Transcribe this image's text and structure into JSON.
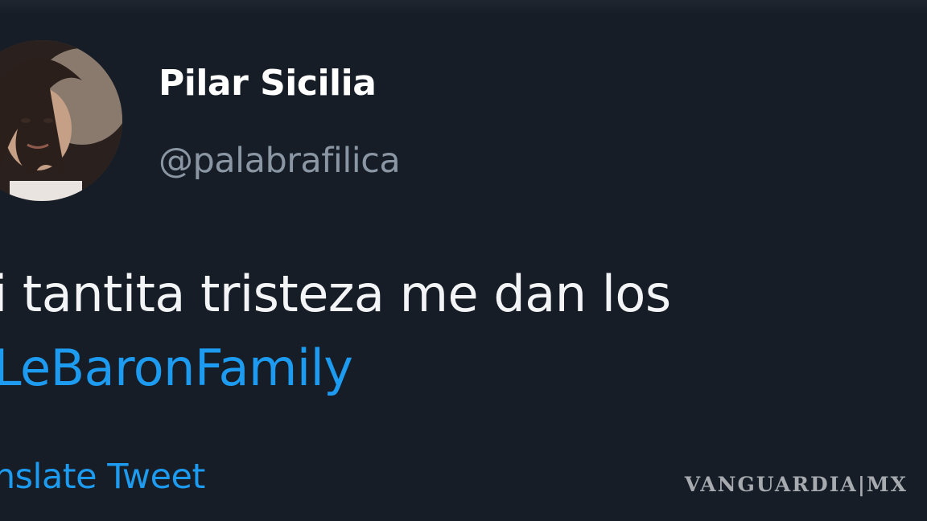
{
  "tweet": {
    "author": {
      "display_name": "Pilar Sicilia",
      "handle": "@palabrafilica",
      "avatar": "profile-photo"
    },
    "text_line1": "i tantita tristeza me dan los",
    "hashtag": "LeBaronFamily",
    "translate_label": "anslate Tweet"
  },
  "watermark": {
    "text": "VANGUARDIA|MX"
  },
  "colors": {
    "background": "#161d26",
    "text": "#f2f4f6",
    "handle": "#8a96a3",
    "link": "#1d9bf0"
  }
}
